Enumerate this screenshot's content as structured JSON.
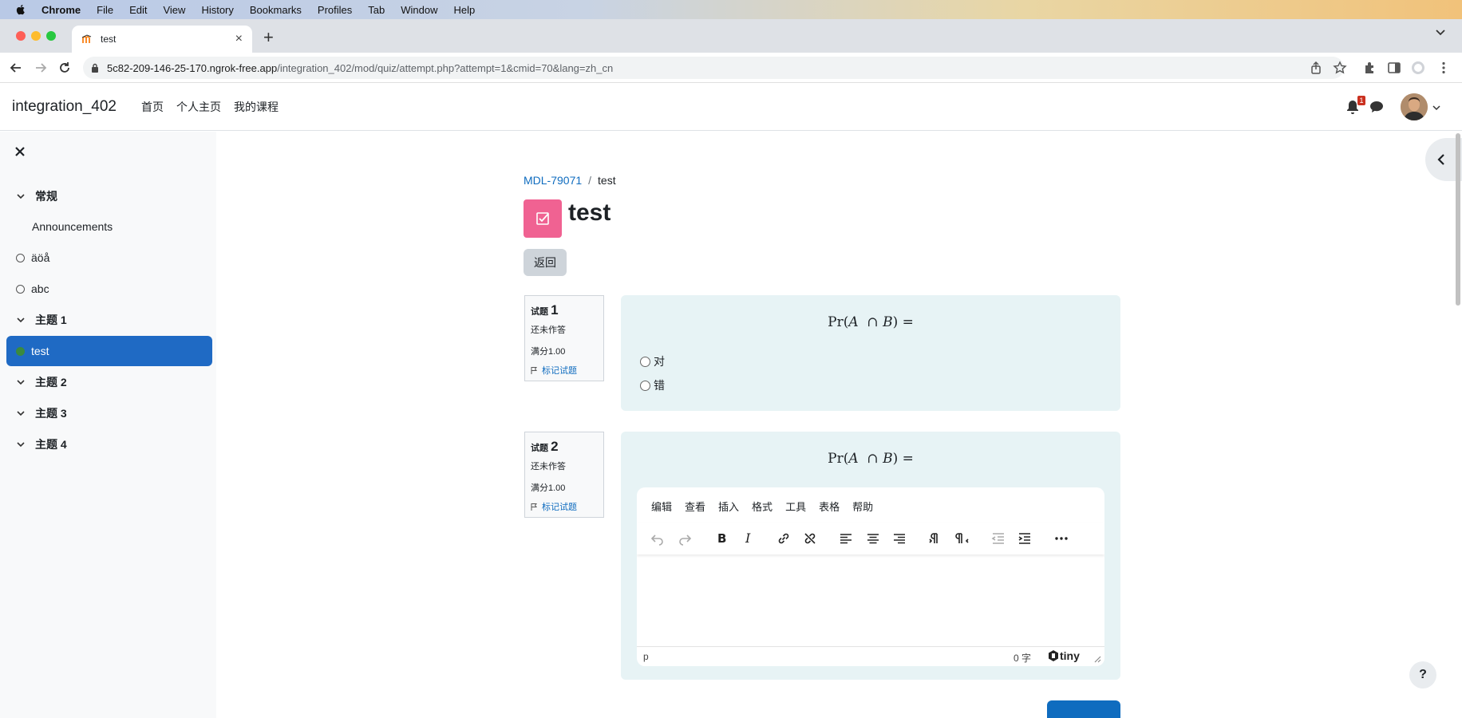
{
  "menubar": {
    "items": [
      "Chrome",
      "File",
      "Edit",
      "View",
      "History",
      "Bookmarks",
      "Profiles",
      "Tab",
      "Window",
      "Help"
    ]
  },
  "browser": {
    "tab_title": "test",
    "url_host": "5c82-209-146-25-170.ngrok-free.app",
    "url_path": "/integration_402/mod/quiz/attempt.php?attempt=1&cmid=70&lang=zh_cn"
  },
  "navbar": {
    "site_name": "integration_402",
    "links": [
      "首页",
      "个人主页",
      "我的课程"
    ],
    "notification_count": "1"
  },
  "course_index": {
    "items": [
      {
        "label": "常规",
        "type": "section"
      },
      {
        "label": "Announcements",
        "type": "activity"
      },
      {
        "label": "äöå",
        "type": "activity-circle"
      },
      {
        "label": "abc",
        "type": "activity-circle"
      },
      {
        "label": "主题 1",
        "type": "section"
      },
      {
        "label": "test",
        "type": "active"
      },
      {
        "label": "主题 2",
        "type": "section"
      },
      {
        "label": "主题 3",
        "type": "section"
      },
      {
        "label": "主题 4",
        "type": "section"
      }
    ]
  },
  "breadcrumb": {
    "course": "MDL-79071",
    "separator": "/",
    "current": "test"
  },
  "page": {
    "title": "test",
    "back_label": "返回",
    "icon_color": "#f06292"
  },
  "questions": [
    {
      "label": "试题",
      "number": "1",
      "status": "还未作答",
      "marks": "满分1.00",
      "flag_label": "标记试题",
      "formula_prefix": "Pr(",
      "formula_a": "A",
      "formula_op": "∩",
      "formula_b": "B",
      "formula_suffix": ") =",
      "options": [
        "对",
        "错"
      ]
    },
    {
      "label": "试题",
      "number": "2",
      "status": "还未作答",
      "marks": "满分1.00",
      "flag_label": "标记试题",
      "formula_prefix": "Pr(",
      "formula_a": "A",
      "formula_op": "∩",
      "formula_b": "B",
      "formula_suffix": ") ="
    }
  ],
  "editor": {
    "menu": [
      "编辑",
      "查看",
      "插入",
      "格式",
      "工具",
      "表格",
      "帮助"
    ],
    "element_path": "p",
    "word_count": "0 字",
    "brand": "tiny"
  },
  "help": {
    "label": "?"
  },
  "colors": {
    "accent": "#0f6cbf",
    "active_item": "#1f6ac4",
    "question_bg": "#e7f3f5"
  }
}
